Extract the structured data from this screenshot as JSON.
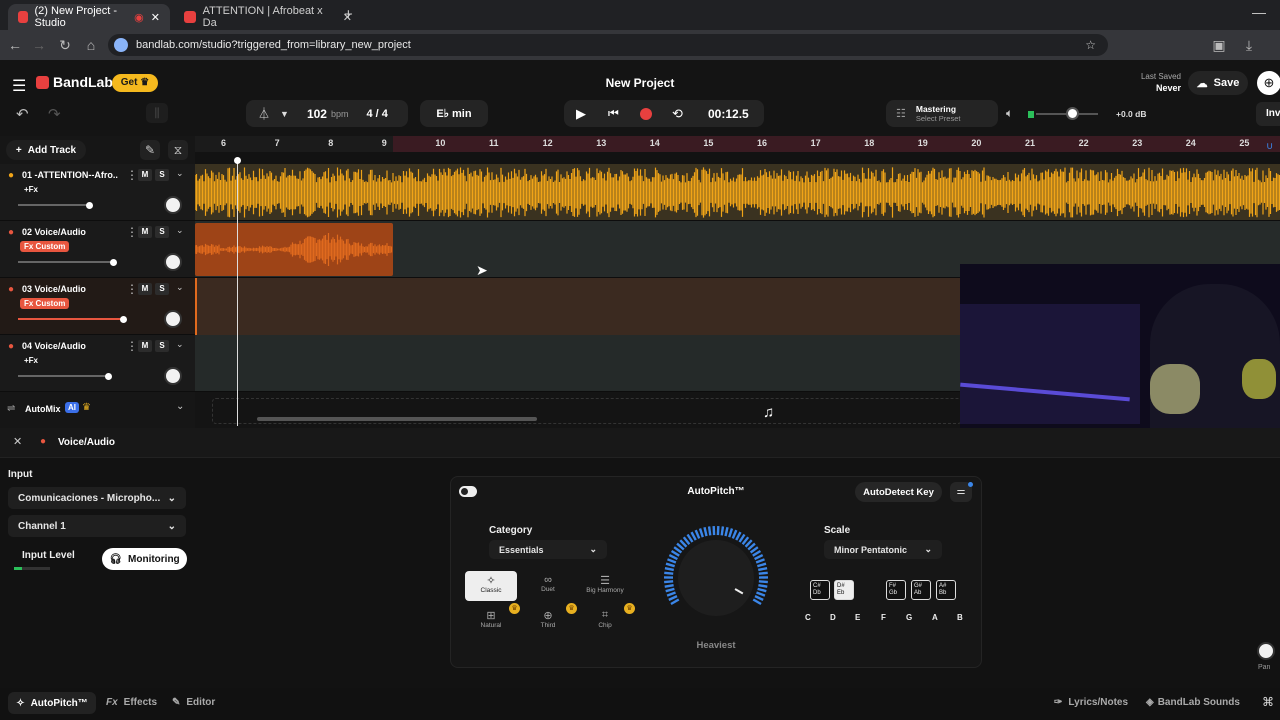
{
  "browser": {
    "tabs": [
      {
        "title": "(2) New Project - Studio"
      },
      {
        "title": "ATTENTION | Afrobeat x Da"
      }
    ],
    "url": "bandlab.com/studio?triggered_from=library_new_project"
  },
  "app": {
    "brand": "BandLab",
    "get_label": "Get",
    "project_title": "New Project",
    "last_saved_label": "Last Saved",
    "last_saved_value": "Never",
    "save_label": "Save",
    "invite_label": "Inv"
  },
  "transport": {
    "bpm": "102",
    "bpm_unit": "bpm",
    "time_sig": "4 / 4",
    "key": "E♭ min",
    "time": "00:12.5",
    "mastering_title": "Mastering",
    "mastering_sub": "Select Preset",
    "volume_db": "+0.0 dB"
  },
  "ruler": {
    "marks": [
      "6",
      "7",
      "8",
      "9",
      "10",
      "11",
      "12",
      "13",
      "14",
      "15",
      "16",
      "17",
      "18",
      "19",
      "20",
      "21",
      "22",
      "23",
      "24",
      "25"
    ]
  },
  "tracks_panel": {
    "add_track_label": "Add Track",
    "automix_label": "AutoMix",
    "ai_badge": "AI"
  },
  "tracks": [
    {
      "name": "01 -ATTENTION--Afro...",
      "fx": "+Fx",
      "fx_custom": false
    },
    {
      "name": "02 Voice/Audio",
      "fx": "Fx Custom",
      "fx_custom": true
    },
    {
      "name": "03 Voice/Audio",
      "fx": "Fx Custom",
      "fx_custom": true
    },
    {
      "name": "04 Voice/Audio",
      "fx": "+Fx",
      "fx_custom": false
    }
  ],
  "track_buttons": {
    "mute": "M",
    "solo": "S"
  },
  "editor": {
    "track_title": "Voice/Audio",
    "input_label": "Input",
    "input_device": "Comunicaciones - Micropho...",
    "channel": "Channel 1",
    "input_level_label": "Input Level",
    "monitoring_label": "Monitoring"
  },
  "autopitch": {
    "title": "AutoPitch™",
    "autodetect_label": "AutoDetect Key",
    "category_label": "Category",
    "category_value": "Essentials",
    "categories": [
      "Classic",
      "Duet",
      "Big Harmony",
      "Natural",
      "Third",
      "Chip"
    ],
    "knob_label": "Heaviest",
    "scale_label": "Scale",
    "scale_value": "Minor Pentatonic",
    "sharp_keys": [
      {
        "top": "C#",
        "bottom": "Db"
      },
      {
        "top": "D#",
        "bottom": "Eb"
      },
      {
        "top": "F#",
        "bottom": "Gb"
      },
      {
        "top": "G#",
        "bottom": "Ab"
      },
      {
        "top": "A#",
        "bottom": "Bb"
      }
    ],
    "natural_keys": [
      "C",
      "D",
      "E",
      "F",
      "G",
      "A",
      "B"
    ]
  },
  "bottom_tabs": {
    "autopitch": "AutoPitch™",
    "effects": "Effects",
    "editor": "Editor",
    "lyrics": "Lyrics/Notes",
    "sounds": "BandLab Sounds",
    "pan": "Pan"
  },
  "colors": {
    "accent_red": "#e8403f",
    "track1_wave": "#f0a418",
    "track2_wave": "#e06a1e",
    "autopitch_ring": "#3b86e8"
  }
}
